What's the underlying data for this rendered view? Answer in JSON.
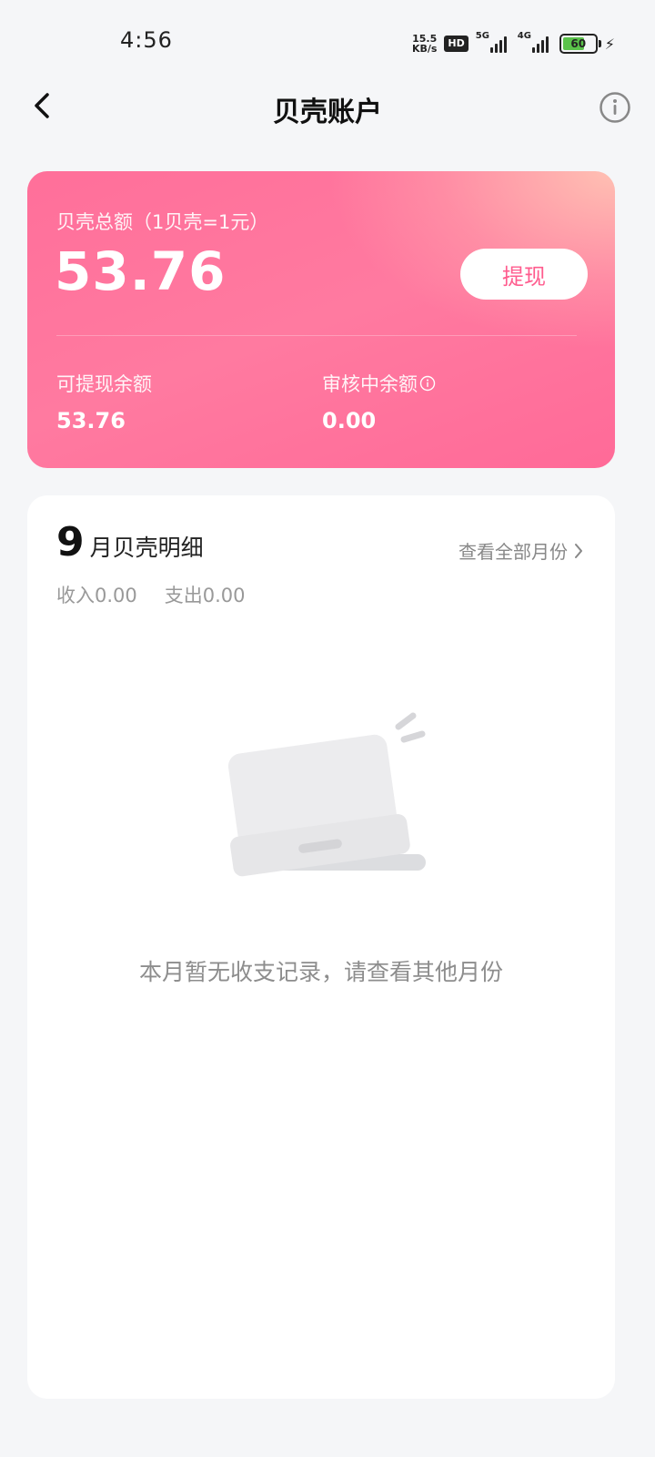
{
  "status_bar": {
    "time": "4:56",
    "net_speed_value": "15.5",
    "net_speed_unit": "KB/s",
    "hd_badge": "HD",
    "signal_1_label": "5G",
    "signal_2_label": "4G",
    "battery_level": "60"
  },
  "header": {
    "title": "贝壳账户"
  },
  "balance_card": {
    "total_label": "贝壳总额（1贝壳=1元）",
    "total_amount": "53.76",
    "withdraw_label": "提现",
    "withdrawable_label": "可提现余额",
    "withdrawable_value": "53.76",
    "pending_label": "审核中余额",
    "pending_value": "0.00"
  },
  "detail_card": {
    "month_number": "9",
    "month_title": "月贝壳明细",
    "view_all_label": "查看全部月份",
    "income_label": "收入0.00",
    "expense_label": "支出0.00",
    "empty_message": "本月暂无收支记录，请查看其他月份"
  },
  "colors": {
    "accent": "#ff6f9a",
    "withdraw_text": "#ff5c8e",
    "background": "#f5f6f8"
  }
}
